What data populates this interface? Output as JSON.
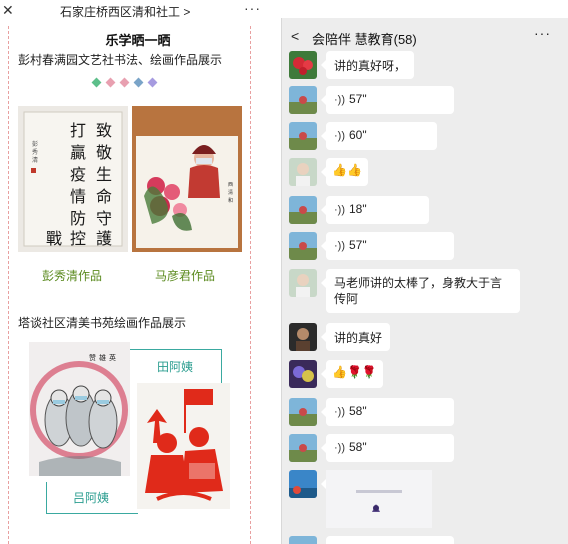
{
  "left": {
    "close_icon": "✕",
    "title": "石家庄桥西区清和社工",
    "title_chevron": ">",
    "more_icon": "···",
    "heading": "乐学晒一晒",
    "subheading": "彭村春满园文艺社书法、绘画作品展示",
    "dot_colors": [
      "#5dbf8a",
      "#e8a0b0",
      "#e8a0b0",
      "#7aa4c8",
      "#a69be0"
    ],
    "calligraphy_text": "致敬生命守護打贏疫情防控戰",
    "artworks": [
      {
        "caption": "彭秀清作品"
      },
      {
        "caption": "马彦君作品"
      }
    ],
    "section2": "塔谈社区清美书苑绘画作品展示",
    "name_top": "田阿姨",
    "name_bottom": "吕阿姨"
  },
  "right": {
    "back_icon": "<",
    "title": "会陪伴  慧教育(58)",
    "more_icon": "···",
    "messages": [
      {
        "type": "text",
        "text": "讲的真好呀，"
      },
      {
        "type": "voice",
        "duration": "57\""
      },
      {
        "type": "voice",
        "duration": "60\""
      },
      {
        "type": "emoji",
        "text": "👍👍"
      },
      {
        "type": "voice",
        "duration": "18\""
      },
      {
        "type": "voice",
        "duration": "57\""
      },
      {
        "type": "text",
        "text": "马老师讲的太棒了，身教大于言传阿"
      },
      {
        "type": "text",
        "text": "讲的真好"
      },
      {
        "type": "emoji",
        "text": "👍🌹🌹"
      },
      {
        "type": "voice",
        "duration": "58\""
      },
      {
        "type": "voice",
        "duration": "58\""
      },
      {
        "type": "card"
      }
    ]
  }
}
